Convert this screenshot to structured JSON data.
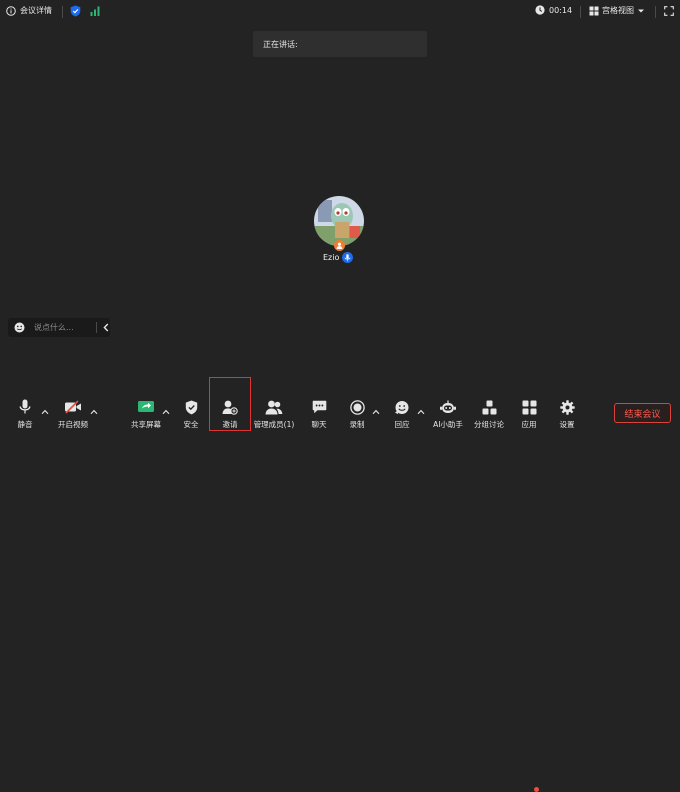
{
  "topbar": {
    "info_label": "会议详情",
    "timer": "00:14",
    "view_label": "宫格视图"
  },
  "speaking": {
    "label": "正在讲话:"
  },
  "participant": {
    "name": "Ezio"
  },
  "chat": {
    "placeholder": "说点什么..."
  },
  "toolbar": {
    "mute": "静音",
    "video": "开启视频",
    "share": "共享屏幕",
    "security": "安全",
    "invite": "邀请",
    "members": "管理成员(1)",
    "chat": "聊天",
    "record": "录制",
    "react": "回应",
    "ai": "AI小助手",
    "breakout": "分组讨论",
    "apps": "应用",
    "settings": "设置",
    "end": "结束会议"
  },
  "colors": {
    "background": "#232323",
    "accent_blue": "#1a6cf0",
    "signal_green": "#2bb673",
    "share_green": "#2bb673",
    "danger": "#ff5a4f",
    "host_orange": "#f27c2b"
  },
  "icons": [
    "info-icon",
    "shield-icon",
    "signal-icon",
    "clock-icon",
    "grid-icon",
    "fullscreen-icon",
    "mic-icon",
    "video-off-icon",
    "share-screen-icon",
    "security-icon",
    "invite-icon",
    "members-icon",
    "chat-icon",
    "record-icon",
    "reaction-icon",
    "ai-assistant-icon",
    "breakout-icon",
    "apps-icon",
    "settings-icon"
  ]
}
